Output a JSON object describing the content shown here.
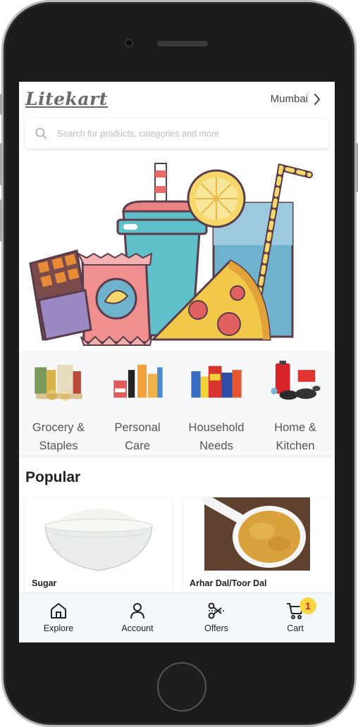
{
  "app": {
    "logo": "Litekart",
    "city": "Mumbai"
  },
  "search": {
    "placeholder": "Search for products, categories and more"
  },
  "categories": [
    {
      "label_line1": "Grocery &",
      "label_line2": "Staples"
    },
    {
      "label_line1": "Personal",
      "label_line2": "Care"
    },
    {
      "label_line1": "Household",
      "label_line2": "Needs"
    },
    {
      "label_line1": "Home &",
      "label_line2": "Kitchen"
    }
  ],
  "popular": {
    "title": "Popular",
    "products": [
      {
        "name": "Sugar"
      },
      {
        "name": "Arhar Dal/Toor Dal"
      }
    ]
  },
  "nav": {
    "explore": "Explore",
    "account": "Account",
    "offers": "Offers",
    "cart": "Cart",
    "cart_count": "1"
  },
  "colors": {
    "brand_logo": "#6b6b6b",
    "badge": "#f7d743",
    "nav_bg": "#f4f7f9",
    "category_bg": "#f6f8fa"
  },
  "icons": [
    "search-icon",
    "chevron-right-icon",
    "home-icon",
    "user-icon",
    "offers-scissors-icon",
    "cart-icon"
  ]
}
